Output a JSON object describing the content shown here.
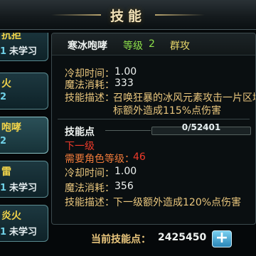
{
  "window": {
    "title": "技能"
  },
  "skill_list": [
    {
      "name": "抗拒",
      "level": "1",
      "status": "未学习",
      "selected": false
    },
    {
      "name": "火",
      "level": "2",
      "status": "",
      "selected": false
    },
    {
      "name": "咆哮",
      "level": "2",
      "status": "",
      "selected": true
    },
    {
      "name": "雷",
      "level": "1",
      "status": "未学习",
      "selected": false
    },
    {
      "name": "炎火",
      "level": "1",
      "status": "未学习",
      "selected": false
    }
  ],
  "detail": {
    "skill_name": "寒冰咆哮",
    "level_label": "等级",
    "level_value": "2",
    "target_type": "群攻",
    "current": {
      "cooldown_label": "冷却时间：",
      "cooldown_value": "1.00",
      "mana_label": "魔法消耗：",
      "mana_value": "333",
      "desc_label": "技能描述：",
      "desc_line1": "召唤狂暴的冰风元素攻击一片区域",
      "desc_line2": "标额外造成115%点伤害"
    },
    "skill_points": {
      "label": "技能点",
      "value_text": "0/52401",
      "current": 0,
      "required": 52401
    },
    "next": {
      "title": "下一级",
      "req_level_label": "需要角色等级：",
      "req_level_value": "46",
      "cooldown_label": "冷却时间：",
      "cooldown_value": "1.00",
      "mana_label": "魔法消耗：",
      "mana_value": "356",
      "desc_label": "技能描述：",
      "desc_text": "下一级额外造成120%点伤害"
    }
  },
  "footer": {
    "points_label": "当前技能点：",
    "points_value": "2425450",
    "add_icon": "plus-icon"
  }
}
